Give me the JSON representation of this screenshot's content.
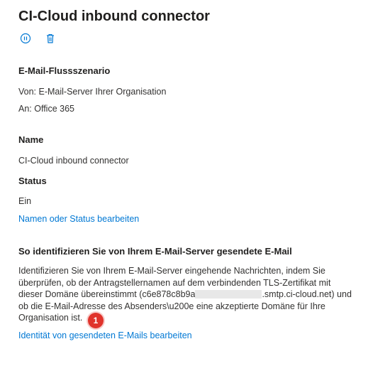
{
  "header": {
    "title": "CI-Cloud inbound connector"
  },
  "toolbar": {
    "pause_icon": "pause-circle-icon",
    "delete_icon": "trash-icon"
  },
  "flow": {
    "heading": "E-Mail-Flussszenario",
    "from": "Von: E-Mail-Server Ihrer Organisation",
    "to": "An: Office 365"
  },
  "name_section": {
    "heading": "Name",
    "value": "CI-Cloud inbound connector"
  },
  "status_section": {
    "heading": "Status",
    "value": "Ein",
    "edit_link": "Namen oder Status bearbeiten"
  },
  "identify_section": {
    "heading": "So identifizieren Sie von Ihrem E-Mail-Server gesendete E-Mail",
    "line1": "Identifizieren Sie von Ihrem E-Mail-Server eingehende Nachrichten, indem Sie",
    "line2": "überprüfen, ob der Antragstellernamen auf dem verbindenden TLS-Zertifikat mit",
    "line3_before": "dieser Domäne übereinstimmt (c6e878c8b9a",
    "line3_after": ".smtp.ci-cloud.net) und",
    "line4": "ob die E-Mail-Adresse des Absenders\\u200e eine akzeptierte Domäne für Ihre",
    "line5": "Organisation ist.",
    "edit_link": "Identität von gesendeten E-Mails bearbeiten"
  },
  "annotation": {
    "badge": "1"
  },
  "colors": {
    "link": "#0078d4",
    "badge": "#e0332c",
    "text": "#323130"
  }
}
